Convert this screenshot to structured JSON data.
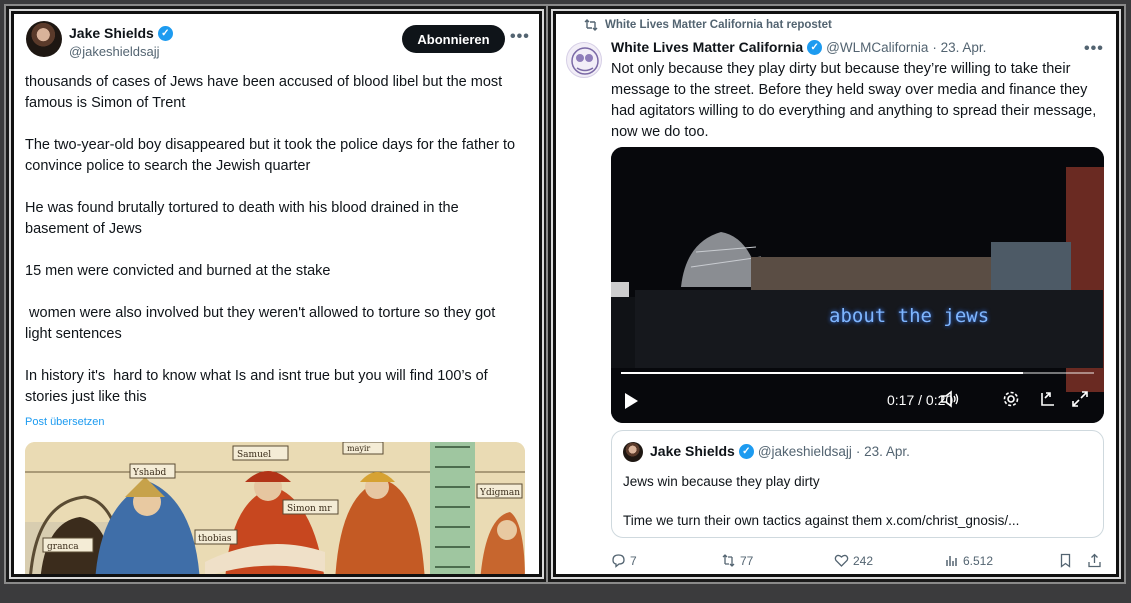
{
  "left_tweet": {
    "author_name": "Jake Shields",
    "handle": "@jakeshieldsajj",
    "follow_label": "Abonnieren",
    "more_label": "•••",
    "paragraphs": [
      "thousands of cases of Jews have been accused of blood libel but the most famous is Simon of Trent",
      "The two-year-old boy disappeared but it took the police days for the father to convince police to search the Jewish quarter",
      "He was found brutally tortured to death with his blood drained in the basement of Jews",
      "15 men were convicted and burned at the stake",
      " women were also involved but they weren't allowed to torture so they got light sentences",
      "In history it's  hard to know what Is and isnt true but you will find 100’s of stories just like this"
    ],
    "translate_label": "Post übersetzen",
    "image_labels": [
      "Samuel",
      "mayir",
      "Yshabd",
      "Simon mr",
      "Ydigman",
      "thobias",
      "granca"
    ]
  },
  "right_tweet": {
    "repost_label": "White Lives Matter California hat repostet",
    "author_name": "White Lives Matter California",
    "handle": "@WLMCalifornia",
    "date": "· 23. Apr.",
    "more_label": "•••",
    "text": "Not only because they play dirty but because they’re willing to take their message to the street. Before they held sway over media and finance they had agitators willing to do everything and anything to spread their message, now we do too.",
    "video": {
      "caption": "about the jews",
      "time": "0:17 / 0:20",
      "progress": 0.85
    },
    "quote": {
      "author_name": "Jake Shields",
      "handle": "@jakeshieldsajj",
      "date": "· 23. Apr.",
      "line1": "Jews win because they play dirty",
      "line2": "Time we turn their own tactics against them x.com/christ_gnosis/..."
    },
    "actions": {
      "replies": "7",
      "reposts": "77",
      "likes": "242",
      "views": "6.512"
    }
  }
}
